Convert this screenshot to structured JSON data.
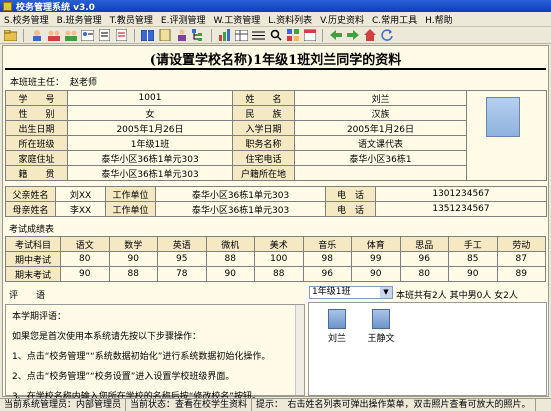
{
  "window": {
    "title": "校务管理系统 v3.0"
  },
  "menu": [
    "S.校务管理",
    "B.班务管理",
    "T.教员管理",
    "E.评测管理",
    "W.工资管理",
    "L.资料列表",
    "V.历史资料",
    "C.常用工具",
    "H.帮助"
  ],
  "toolbar_icons": [
    "open-folder-icon",
    "user-icon",
    "group-icon",
    "group-icon",
    "user-card-icon",
    "document-icon",
    "document-icon",
    "book-icon",
    "notebook-icon",
    "users-icon",
    "tree-icon",
    "chart-icon",
    "table-icon",
    "list-icon",
    "search-icon",
    "grid-icon",
    "calendar-icon",
    "arrow-left-icon",
    "arrow-right-icon",
    "home-icon",
    "refresh-icon"
  ],
  "page": {
    "title": "(请设置学校名称)1年级1班刘兰同学的资料",
    "teacher_label": "本班班主任：",
    "teacher_name": "赵老师"
  },
  "profile": {
    "rows": [
      [
        "学　　号",
        "1001",
        "姓　　名",
        "刘兰"
      ],
      [
        "性　　别",
        "女",
        "民　　族",
        "汉族"
      ],
      [
        "出生日期",
        "2005年1月26日",
        "入学日期",
        "2005年1月26日"
      ],
      [
        "所在班级",
        "1年级1班",
        "职务名称",
        "语文课代表"
      ],
      [
        "家庭住址",
        "泰华小区36栋1单元303",
        "住宅电话",
        "泰华小区36栋1"
      ],
      [
        "籍　　贯",
        "泰华小区36栋1单元303",
        "户籍所在地",
        ""
      ]
    ]
  },
  "parents": [
    {
      "role": "父亲姓名",
      "name": "刘XX",
      "work_label": "工作单位",
      "work": "泰华小区36栋1单元303",
      "phone_label": "电　话",
      "phone": "1301234567"
    },
    {
      "role": "母亲姓名",
      "name": "李XX",
      "work_label": "工作单位",
      "work": "泰华小区36栋1单元303",
      "phone_label": "电　话",
      "phone": "1351234567"
    }
  ],
  "scores": {
    "section_label": "考试成绩表",
    "headers": [
      "考试科目",
      "语文",
      "数学",
      "英语",
      "微机",
      "美术",
      "音乐",
      "体育",
      "思品",
      "手工",
      "劳动"
    ],
    "rows": [
      [
        "期中考试",
        "80",
        "90",
        "95",
        "88",
        "100",
        "98",
        "99",
        "96",
        "85",
        "87"
      ],
      [
        "期末考试",
        "90",
        "88",
        "78",
        "90",
        "88",
        "96",
        "90",
        "80",
        "90",
        "89"
      ]
    ]
  },
  "comments": {
    "label": "评　　语",
    "lines": [
      "本学期评语：",
      "如果您是首次使用本系统请先按以下步骤操作：",
      "1、点击“校务管理”“系统数据初始化”进行系统数据初始化操作。",
      "2、点击“校务管理”“校务设置”进入设置学校班级界面。",
      "3、在学校名称内输入您所在学校的名称后按“修改校名”按钮。"
    ]
  },
  "roster": {
    "class_value": "1年级1班",
    "summary": "本班共有2人 其中男0人 女2人",
    "students": [
      "刘兰",
      "王静文"
    ]
  },
  "status": {
    "admin_label": "当前系统管理员：",
    "admin_value": "内部管理员",
    "state": "当前状态：查看在校学生资料",
    "hint": "提示：　右击姓名列表可弹出操作菜单，双击照片查看可放大的照片。"
  }
}
